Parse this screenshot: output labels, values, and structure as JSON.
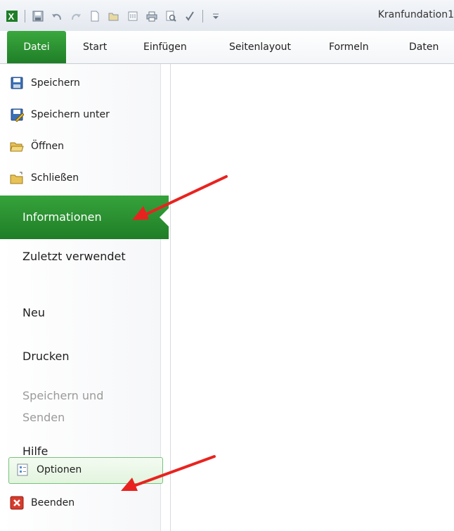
{
  "window": {
    "doc_title": "Kranfundation1"
  },
  "quick_access": {
    "icons": [
      "excel-icon",
      "save-icon",
      "undo-icon",
      "redo-icon",
      "new-icon",
      "open-icon",
      "attach-icon",
      "print-icon",
      "print-preview-icon",
      "spelling-icon",
      "customize-qat-icon"
    ]
  },
  "ribbon": {
    "tabs": [
      {
        "label": "Datei",
        "active": true
      },
      {
        "label": "Start"
      },
      {
        "label": "Einfügen"
      },
      {
        "label": "Seitenlayout"
      },
      {
        "label": "Formeln"
      },
      {
        "label": "Daten"
      }
    ]
  },
  "backstage": {
    "commands": [
      {
        "label": "Speichern",
        "icon": "save-icon"
      },
      {
        "label": "Speichern unter",
        "icon": "save-as-icon"
      },
      {
        "label": "Öffnen",
        "icon": "open-folder-icon"
      },
      {
        "label": "Schließen",
        "icon": "close-folder-icon"
      }
    ],
    "selected": "Informationen",
    "items": [
      {
        "label": "Zuletzt verwendet"
      },
      {
        "label": "Neu"
      },
      {
        "label": "Drucken"
      },
      {
        "label": "Speichern und Senden",
        "disabled": true
      },
      {
        "label": "Hilfe"
      }
    ],
    "bottom_commands": [
      {
        "label": "Optionen",
        "icon": "options-icon",
        "highlighted": true
      },
      {
        "label": "Beenden",
        "icon": "exit-icon"
      }
    ]
  },
  "annotations": {
    "arrow_color": "#e8231f"
  },
  "colors": {
    "file_tab": "#2a8f30",
    "selected_item": "#2a8f30"
  }
}
